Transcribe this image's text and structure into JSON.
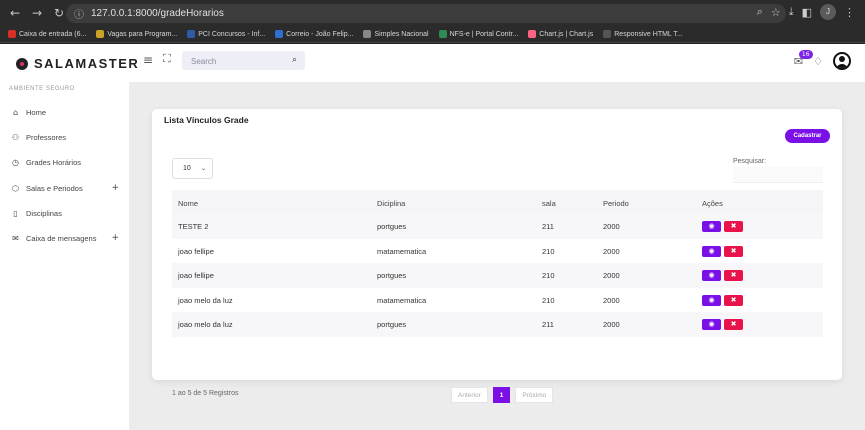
{
  "browser": {
    "url": "127.0.0.1:8000/gradeHorarios",
    "profile_initial": "J",
    "bookmarks": [
      {
        "label": "Caixa de entrada (6...",
        "color": "#d93025"
      },
      {
        "label": "Vagas para Program...",
        "color": "#c9a227"
      },
      {
        "label": "PCI Concursos - Inf...",
        "color": "#2d5ba8"
      },
      {
        "label": "Correio - João Felip...",
        "color": "#2f6fd1"
      },
      {
        "label": "Simples Nacional",
        "color": "#888888"
      },
      {
        "label": "NFS-e | Portal Contr...",
        "color": "#2e8b57"
      },
      {
        "label": "Chart.js | Chart.js",
        "color": "#ff6384"
      },
      {
        "label": "Responsive HTML T...",
        "color": "#555555"
      }
    ]
  },
  "topbar": {
    "brand": "SALAMASTER",
    "search_placeholder": "Search",
    "notification_count": "16"
  },
  "sidebar": {
    "section_title": "AMBIENTE SEGURO",
    "items": [
      {
        "label": "Home",
        "icon": "home-icon",
        "glyph": "⌂",
        "expandable": false
      },
      {
        "label": "Professores",
        "icon": "users-icon",
        "glyph": "⚇",
        "expandable": false
      },
      {
        "label": "Grades Horários",
        "icon": "clock-icon",
        "glyph": "◷",
        "expandable": false
      },
      {
        "label": "Salas e Periodos",
        "icon": "box-icon",
        "glyph": "⬡",
        "expandable": true
      },
      {
        "label": "Disciplinas",
        "icon": "book-icon",
        "glyph": "▯",
        "expandable": false
      },
      {
        "label": "Caixa de mensagens",
        "icon": "mail-icon",
        "glyph": "✉",
        "expandable": true
      }
    ]
  },
  "main": {
    "card_title": "Lista Vínculos Grade",
    "create_button": "Cadastrar",
    "page_length": "10",
    "search_label": "Pesquisar:",
    "columns": [
      "Nome",
      "Diciplina",
      "sala",
      "Periodo",
      "Ações"
    ],
    "rows": [
      {
        "nome": "TESTE 2",
        "disciplina": "portgues",
        "sala": "211",
        "periodo": "2000"
      },
      {
        "nome": "joao fellipe",
        "disciplina": "matamematica",
        "sala": "210",
        "periodo": "2000"
      },
      {
        "nome": "joao fellipe",
        "disciplina": "portgues",
        "sala": "210",
        "periodo": "2000"
      },
      {
        "nome": "joao melo da luz",
        "disciplina": "matamematica",
        "sala": "210",
        "periodo": "2000"
      },
      {
        "nome": "joao melo da luz",
        "disciplina": "portgues",
        "sala": "211",
        "periodo": "2000"
      }
    ],
    "info_text": "1 ao 5 de 5 Registros",
    "pagination": {
      "prev": "Anterior",
      "current": "1",
      "next": "Próximo"
    }
  },
  "colors": {
    "accent": "#7b10e6",
    "danger": "#e8134a"
  }
}
